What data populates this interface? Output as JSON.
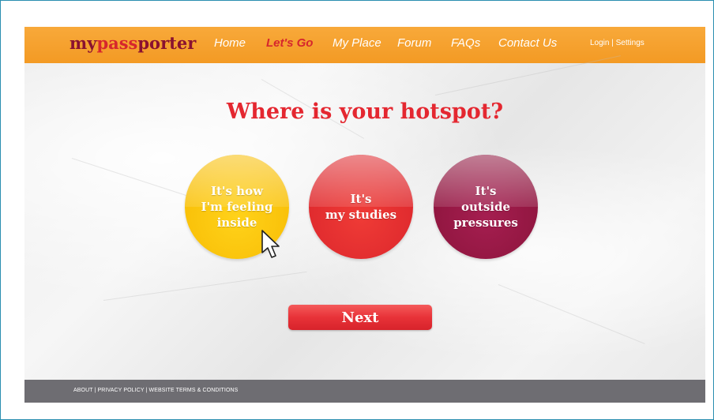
{
  "brand": {
    "logo_my": "my",
    "logo_pass": "pass",
    "logo_porter": "porter"
  },
  "nav": {
    "items": [
      {
        "label": "Home",
        "active": false
      },
      {
        "label": "Let's Go",
        "active": true
      },
      {
        "label": "My Place",
        "active": false
      },
      {
        "label": "Forum",
        "active": false
      },
      {
        "label": "FAQs",
        "active": false
      },
      {
        "label": "Contact Us",
        "active": false
      }
    ],
    "login": "Login",
    "separator": "|",
    "settings": "Settings"
  },
  "main": {
    "heading": "Where is your hotspot?",
    "options": [
      {
        "label": "It's how\nI'm feeling\ninside",
        "color": "#f6b800"
      },
      {
        "label": "It's\nmy studies",
        "color": "#d8222a"
      },
      {
        "label": "It's\noutside\npressures",
        "color": "#871238"
      }
    ],
    "next_label": "Next"
  },
  "footer": {
    "about": "ABOUT",
    "privacy": "PRIVACY POLICY",
    "terms": "WEBSITE TERMS & CONDITIONS",
    "separator": " | "
  },
  "colors": {
    "header": "#f39a24",
    "accent_red": "#e42730",
    "footer": "#6e6d72"
  }
}
